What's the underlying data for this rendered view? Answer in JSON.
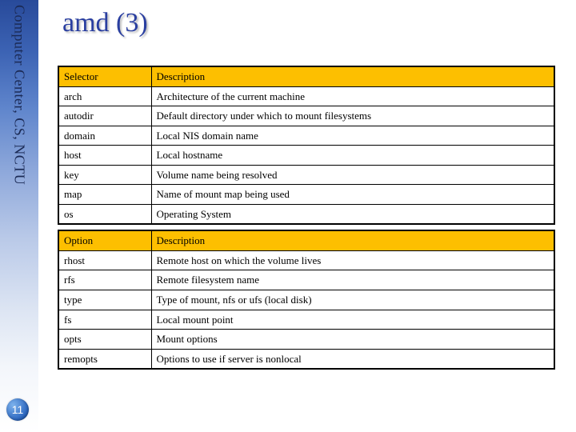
{
  "sidebar_label": "Computer Center, CS, NCTU",
  "page_number": "11",
  "title": "amd (3)",
  "table1": {
    "header": {
      "col1": "Selector",
      "col2": "Description"
    },
    "rows": [
      {
        "col1": "arch",
        "col2": "Architecture of the current machine"
      },
      {
        "col1": "autodir",
        "col2": "Default directory under which to mount filesystems"
      },
      {
        "col1": "domain",
        "col2": "Local NIS domain name"
      },
      {
        "col1": "host",
        "col2": "Local hostname"
      },
      {
        "col1": "key",
        "col2": "Volume name being resolved"
      },
      {
        "col1": "map",
        "col2": "Name of mount map being used"
      },
      {
        "col1": "os",
        "col2": "Operating System"
      }
    ]
  },
  "table2": {
    "header": {
      "col1": "Option",
      "col2": "Description"
    },
    "rows": [
      {
        "col1": "rhost",
        "col2": "Remote host on which the volume lives"
      },
      {
        "col1": "rfs",
        "col2": "Remote filesystem name"
      },
      {
        "col1": "type",
        "col2": "Type of mount, nfs or ufs (local disk)"
      },
      {
        "col1": "fs",
        "col2": "Local mount point"
      },
      {
        "col1": "opts",
        "col2": "Mount options"
      },
      {
        "col1": "remopts",
        "col2": "Options to use if server is nonlocal"
      }
    ]
  }
}
